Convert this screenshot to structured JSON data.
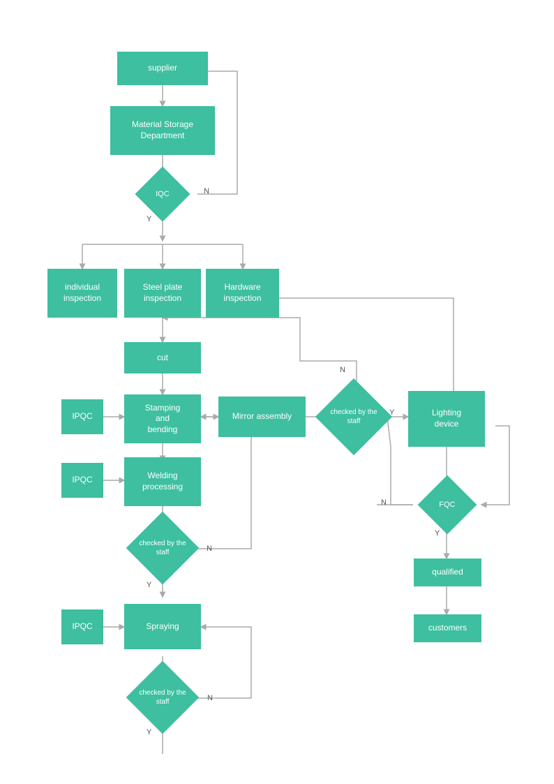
{
  "nodes": {
    "supplier": {
      "label": "supplier"
    },
    "material_storage": {
      "label": "Material Storage\nDepartment"
    },
    "iqc": {
      "label": "IQC"
    },
    "individual_inspection": {
      "label": "individual\ninspection"
    },
    "steel_plate": {
      "label": "Steel plate\ninspection"
    },
    "hardware_inspection": {
      "label": "Hardware\ninspection"
    },
    "cut": {
      "label": "cut"
    },
    "stamping": {
      "label": "Stamping\nand\nbending"
    },
    "welding": {
      "label": "Welding\nprocessing"
    },
    "checked1": {
      "label": "checked by\nthe staff"
    },
    "spraying": {
      "label": "Spraying"
    },
    "checked2": {
      "label": "checked by\nthe staff"
    },
    "mirror_assembly": {
      "label": "Mirror assembly"
    },
    "checked3": {
      "label": "checked\nby the\nstaff"
    },
    "lighting": {
      "label": "Lighting\ndevice"
    },
    "fqc": {
      "label": "FQC"
    },
    "qualified": {
      "label": "qualified"
    },
    "customers": {
      "label": "customers"
    },
    "ipqc1": {
      "label": "IPQC"
    },
    "ipqc2": {
      "label": "IPQC"
    },
    "ipqc3": {
      "label": "IPQC"
    }
  },
  "labels": {
    "y": "Y",
    "n": "N"
  }
}
